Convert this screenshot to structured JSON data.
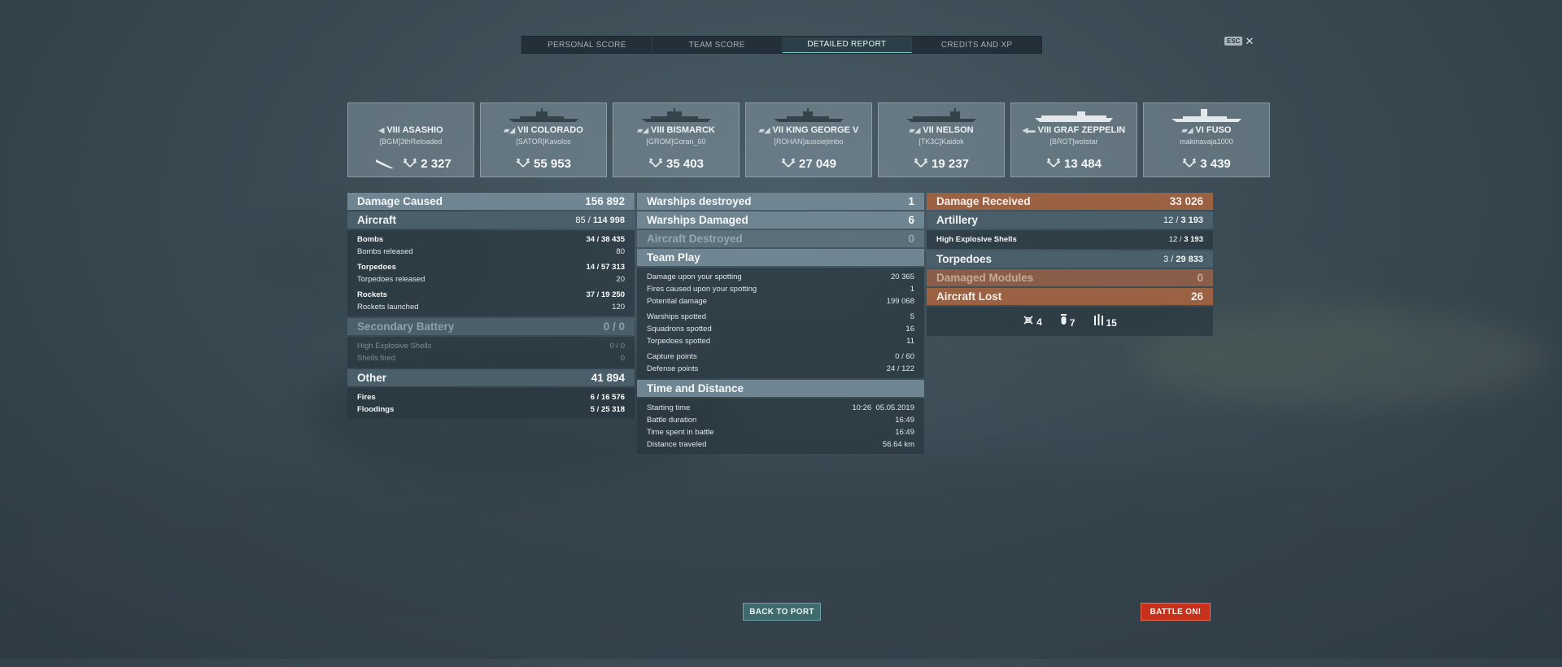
{
  "tabs": [
    {
      "label": "PERSONAL SCORE"
    },
    {
      "label": "TEAM SCORE"
    },
    {
      "label": "DETAILED REPORT"
    },
    {
      "label": "CREDITS AND XP"
    }
  ],
  "active_tab": "DETAILED REPORT",
  "esc": {
    "key": "ESC",
    "close": "✕"
  },
  "ships": [
    {
      "class": "◀",
      "name": "VIII ASASHIO",
      "player": "[BGM]3thReloaded",
      "score": "2 327"
    },
    {
      "class": "▰◢",
      "name": "VII COLORADO",
      "player": "[SATOR]Kavolos",
      "score": "55 953"
    },
    {
      "class": "▰◢",
      "name": "VIII BISMARCK",
      "player": "[GROM]Goran_60",
      "score": "35 403"
    },
    {
      "class": "▰◢",
      "name": "VII KING GEORGE V",
      "player": "[ROHAN]aussiejimbo",
      "score": "27 049"
    },
    {
      "class": "▰◢",
      "name": "VII NELSON",
      "player": "[TK3C]Kaidok",
      "score": "19 237"
    },
    {
      "class": "◀▬",
      "name": "VIII GRAF ZEPPELIN",
      "player": "[BROT]wotstar",
      "score": "13 484"
    },
    {
      "class": "▰◢",
      "name": "VI FUSO",
      "player": "makinavaja1000",
      "score": "3 439"
    }
  ],
  "left": {
    "damage_caused": {
      "label": "Damage Caused",
      "value": "156 892"
    },
    "aircraft": {
      "label": "Aircraft",
      "hits": "85",
      "total": "114 998"
    },
    "bombs": {
      "label": "Bombs",
      "hits": "34",
      "total": "38 435"
    },
    "bombs_released": {
      "label": "Bombs released",
      "value": "80"
    },
    "torpedoes": {
      "label": "Torpedoes",
      "hits": "14",
      "total": "57 313"
    },
    "torpedoes_released": {
      "label": "Torpedoes released",
      "value": "20"
    },
    "rockets": {
      "label": "Rockets",
      "hits": "37",
      "total": "19 250"
    },
    "rockets_launched": {
      "label": "Rockets launched",
      "value": "120"
    },
    "secondary": {
      "label": "Secondary Battery",
      "value": "0 / 0"
    },
    "he_shells": {
      "label": "High Explosive Shells",
      "hits": "0",
      "total": "0"
    },
    "shells_fired": {
      "label": "Shells fired",
      "value": "0"
    },
    "other": {
      "label": "Other",
      "value": "41 894"
    },
    "fires": {
      "label": "Fires",
      "hits": "6",
      "total": "16 576"
    },
    "floodings": {
      "label": "Floodings",
      "hits": "5",
      "total": "25 318"
    }
  },
  "middle": {
    "warships_destroyed": {
      "label": "Warships destroyed",
      "value": "1"
    },
    "warships_damaged": {
      "label": "Warships Damaged",
      "value": "6"
    },
    "aircraft_destroyed": {
      "label": "Aircraft Destroyed",
      "value": "0"
    },
    "team_play": {
      "label": "Team Play"
    },
    "rows1": [
      {
        "label": "Damage upon your spotting",
        "value": "20 365"
      },
      {
        "label": "Fires caused upon your spotting",
        "value": "1"
      },
      {
        "label": "Potential damage",
        "value": "199 068"
      }
    ],
    "rows2": [
      {
        "label": "Warships spotted",
        "value": "5"
      },
      {
        "label": "Squadrons spotted",
        "value": "16"
      },
      {
        "label": "Torpedoes spotted",
        "value": "11"
      }
    ],
    "rows3": [
      {
        "label": "Capture points",
        "value": "0 / 60"
      },
      {
        "label": "Defense points",
        "value": "24 / 122"
      }
    ],
    "time_distance": {
      "label": "Time and Distance"
    },
    "rows4": [
      {
        "label": "Starting time",
        "value": "10:26  05.05.2019"
      },
      {
        "label": "Battle duration",
        "value": "16:49"
      },
      {
        "label": "Time spent in battle",
        "value": "16:49"
      },
      {
        "label": "Distance traveled",
        "value": "56.64 km"
      }
    ]
  },
  "right": {
    "damage_received": {
      "label": "Damage Received",
      "value": "33 026"
    },
    "artillery": {
      "label": "Artillery",
      "hits": "12",
      "total": "3 193"
    },
    "he_shells": {
      "label": "High Explosive Shells",
      "hits": "12",
      "total": "3 193"
    },
    "torpedoes": {
      "label": "Torpedoes",
      "hits": "3",
      "total": "29 833"
    },
    "damaged_modules": {
      "label": "Damaged Modules",
      "value": "0"
    },
    "aircraft_lost": {
      "label": "Aircraft Lost",
      "value": "26"
    },
    "lost_icons": [
      {
        "icon": "fighter-icon",
        "value": "4"
      },
      {
        "icon": "bomber-icon",
        "value": "7"
      },
      {
        "icon": "rocket-icon",
        "value": "15"
      }
    ]
  },
  "buttons": {
    "back": "BACK TO PORT",
    "battle": "BATTLE ON!"
  }
}
